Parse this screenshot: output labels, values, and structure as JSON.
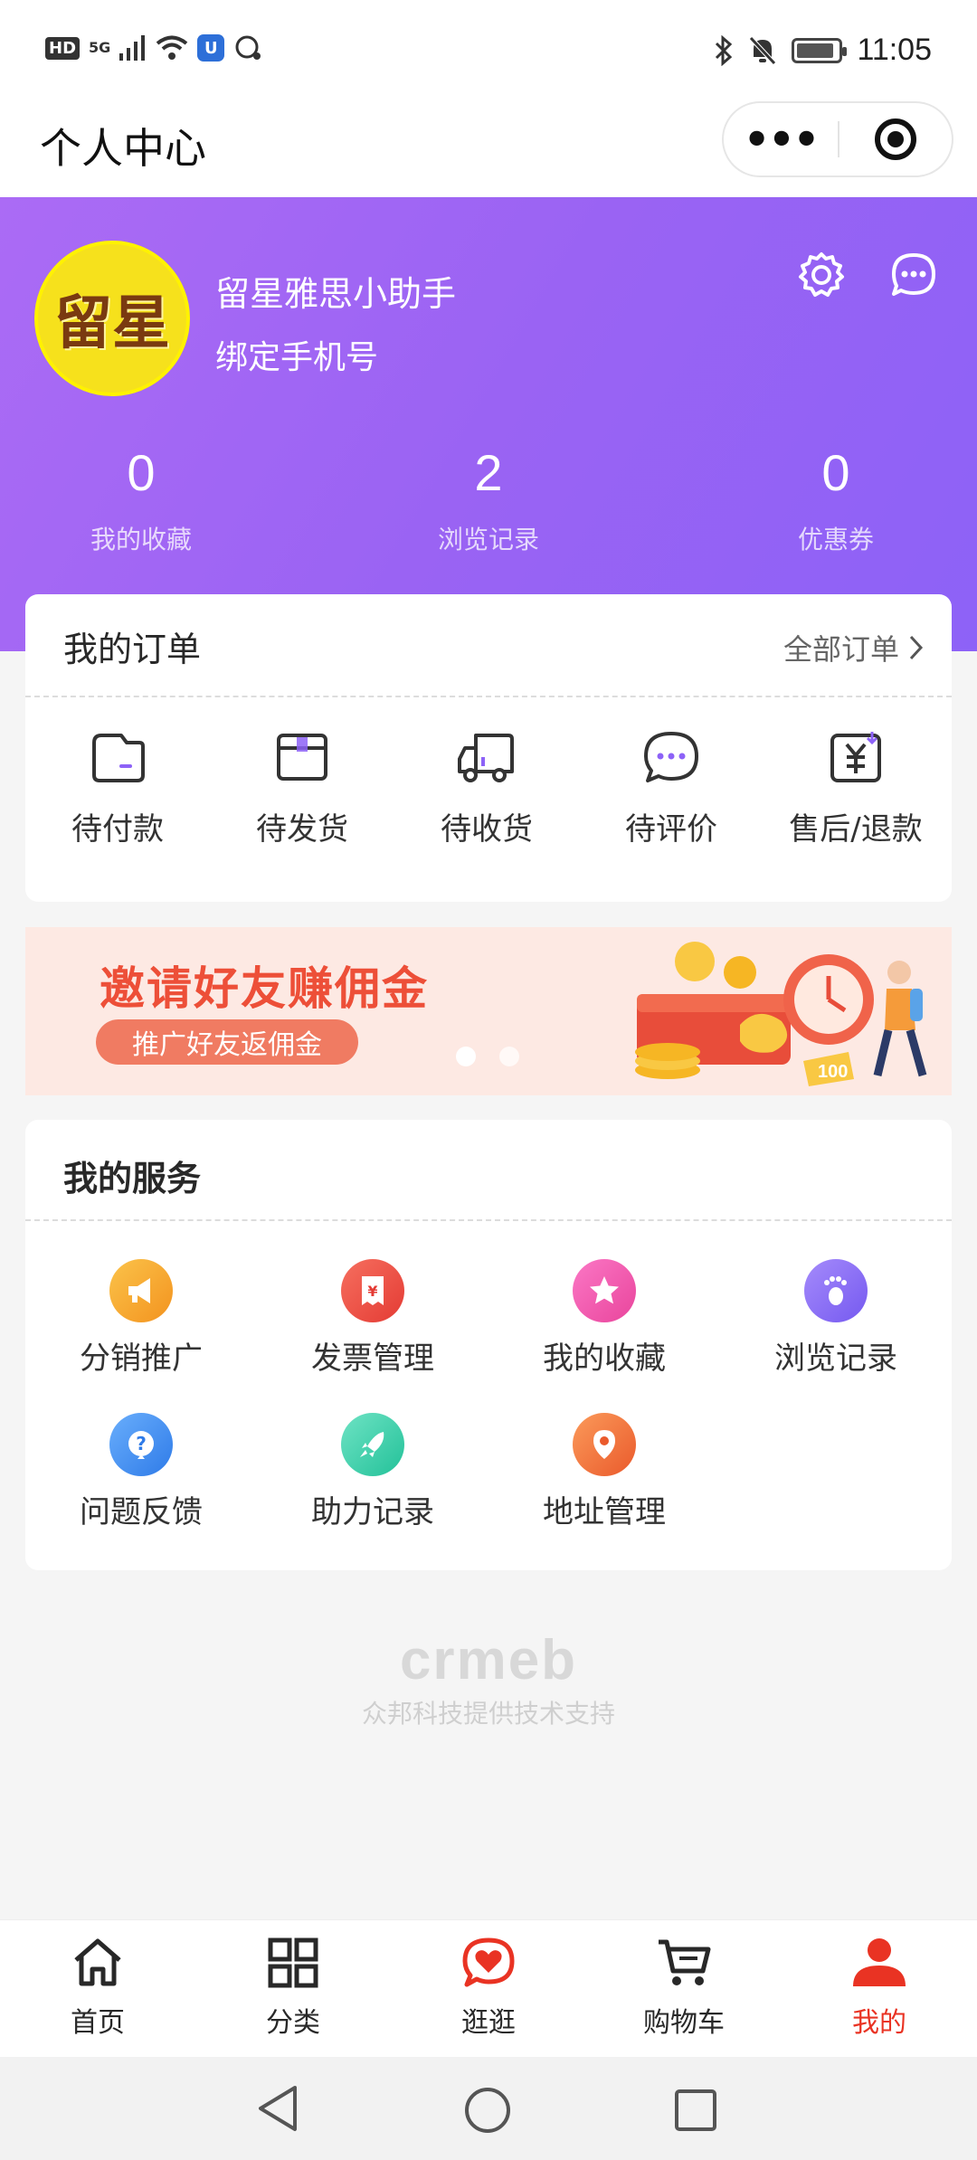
{
  "status_bar": {
    "left": {
      "hd": "HD",
      "network": "5G"
    },
    "time": "11:05"
  },
  "title_bar": {
    "title": "个人中心"
  },
  "profile": {
    "avatar_text": "留星",
    "username": "留星雅思小助手",
    "bind_phone": "绑定手机号",
    "stats": [
      {
        "value": "0",
        "label": "我的收藏"
      },
      {
        "value": "2",
        "label": "浏览记录"
      },
      {
        "value": "0",
        "label": "优惠券"
      }
    ]
  },
  "orders": {
    "title": "我的订单",
    "all_link": "全部订单",
    "items": [
      {
        "label": "待付款",
        "icon": "wallet-icon"
      },
      {
        "label": "待发货",
        "icon": "box-icon"
      },
      {
        "label": "待收货",
        "icon": "truck-icon"
      },
      {
        "label": "待评价",
        "icon": "comment-icon"
      },
      {
        "label": "售后/退款",
        "icon": "refund-icon"
      }
    ]
  },
  "banner": {
    "title": "邀请好友赚佣金",
    "pill": "推广好友返佣金",
    "badge": "100"
  },
  "services": {
    "title": "我的服务",
    "items": [
      {
        "label": "分销推广",
        "icon": "megaphone-icon",
        "color": "#f5a623"
      },
      {
        "label": "发票管理",
        "icon": "invoice-icon",
        "color": "#ef4a3c"
      },
      {
        "label": "我的收藏",
        "icon": "star-icon",
        "color": "#f04aa0"
      },
      {
        "label": "浏览记录",
        "icon": "footprint-icon",
        "color": "#8d6cf6"
      },
      {
        "label": "问题反馈",
        "icon": "question-icon",
        "color": "#3b8cf7"
      },
      {
        "label": "助力记录",
        "icon": "rocket-icon",
        "color": "#34cfa8"
      },
      {
        "label": "地址管理",
        "icon": "location-icon",
        "color": "#f26a3d"
      }
    ]
  },
  "footer": {
    "logo": "crmeb",
    "support": "众邦科技提供技术支持"
  },
  "tabbar": {
    "items": [
      {
        "label": "首页",
        "icon": "home-icon"
      },
      {
        "label": "分类",
        "icon": "category-icon"
      },
      {
        "label": "逛逛",
        "icon": "heart-chat-icon"
      },
      {
        "label": "购物车",
        "icon": "cart-icon"
      },
      {
        "label": "我的",
        "icon": "user-icon"
      }
    ],
    "active_color": "#e93323"
  }
}
